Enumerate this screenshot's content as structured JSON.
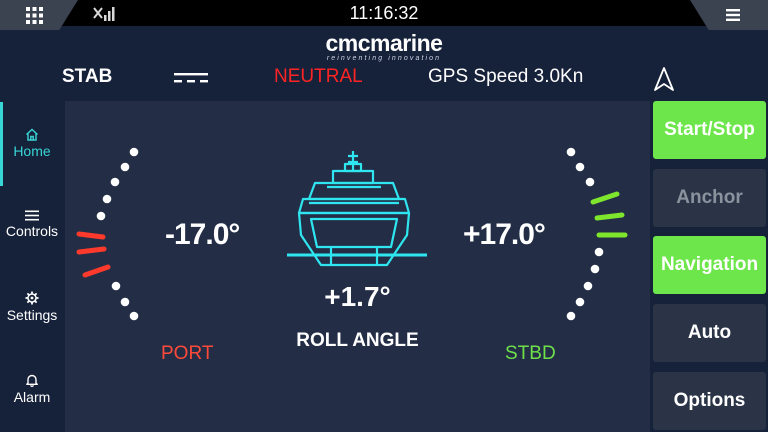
{
  "topbar": {
    "clock": "11:16:32",
    "apps_icon": "grid-icon",
    "menu_icon": "hamburger-menu-icon",
    "signal_icon": "no-signal-icon"
  },
  "header": {
    "logo_main": "cmcmarine",
    "logo_sub": "reinventing innovation",
    "mode": "STAB",
    "status": "NEUTRAL",
    "gps": "GPS Speed 3.0Kn",
    "status_color": "#ff2424"
  },
  "sidebar": {
    "items": [
      {
        "label": "Home",
        "icon": "home-icon",
        "active": true
      },
      {
        "label": "Controls",
        "icon": "list-icon",
        "active": false
      },
      {
        "label": "Settings",
        "icon": "gear-icon",
        "active": false
      },
      {
        "label": "Alarm",
        "icon": "bell-icon",
        "active": false
      }
    ],
    "accent": "#38d6d6"
  },
  "main": {
    "port_angle": "-17.0°",
    "stbd_angle": "+17.0°",
    "roll_value": "+1.7°",
    "roll_label": "ROLL ANGLE",
    "port_label": "PORT",
    "stbd_label": "STBD",
    "port_color": "#ff4a3a",
    "stbd_color": "#6ee04a",
    "ship_color": "#2fe6f0"
  },
  "buttons": [
    {
      "label": "Start/Stop",
      "state": "active"
    },
    {
      "label": "Anchor",
      "state": "disabled"
    },
    {
      "label": "Navigation",
      "state": "active"
    },
    {
      "label": "Auto",
      "state": "normal"
    },
    {
      "label": "Options",
      "state": "normal"
    }
  ]
}
